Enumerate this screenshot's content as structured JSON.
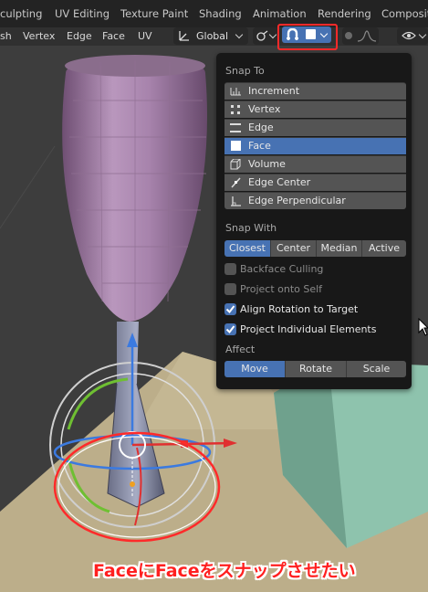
{
  "workspaces": [
    "culpting",
    "UV Editing",
    "Texture Paint",
    "Shading",
    "Animation",
    "Rendering",
    "Compositi"
  ],
  "header": {
    "menus": [
      "sh",
      "Vertex",
      "Edge",
      "Face",
      "UV"
    ],
    "orientation_label": "Global"
  },
  "snap_popover": {
    "snap_to_heading": "Snap To",
    "snap_to_items": [
      {
        "label": "Increment",
        "icon": "increment-icon",
        "active": false
      },
      {
        "label": "Vertex",
        "icon": "vertex-icon",
        "active": false
      },
      {
        "label": "Edge",
        "icon": "edge-icon",
        "active": false
      },
      {
        "label": "Face",
        "icon": "face-icon",
        "active": true
      },
      {
        "label": "Volume",
        "icon": "volume-icon",
        "active": false
      },
      {
        "label": "Edge Center",
        "icon": "edge-center-icon",
        "active": false
      },
      {
        "label": "Edge Perpendicular",
        "icon": "edge-perpendicular-icon",
        "active": false
      }
    ],
    "snap_with_heading": "Snap With",
    "snap_with_options": [
      {
        "label": "Closest",
        "active": true
      },
      {
        "label": "Center",
        "active": false
      },
      {
        "label": "Median",
        "active": false
      },
      {
        "label": "Active",
        "active": false
      }
    ],
    "options": [
      {
        "label": "Backface Culling",
        "checked": false,
        "enabled": false
      },
      {
        "label": "Project onto Self",
        "checked": false,
        "enabled": false
      },
      {
        "label": "Align Rotation to Target",
        "checked": true,
        "enabled": true
      },
      {
        "label": "Project Individual Elements",
        "checked": true,
        "enabled": true
      }
    ],
    "affect_heading": "Affect",
    "affect_options": [
      {
        "label": "Move",
        "active": true
      },
      {
        "label": "Rotate",
        "active": false
      },
      {
        "label": "Scale",
        "active": false
      }
    ]
  },
  "annotation": "FaceにFaceをスナップさせたい",
  "colors": {
    "accent": "#4772b3",
    "annotation_red": "#ff2020",
    "popover_bg": "#181818",
    "object_purple": "#b089b4",
    "floor_tan": "#b8aa86",
    "green_object": "#7fb8a0"
  }
}
